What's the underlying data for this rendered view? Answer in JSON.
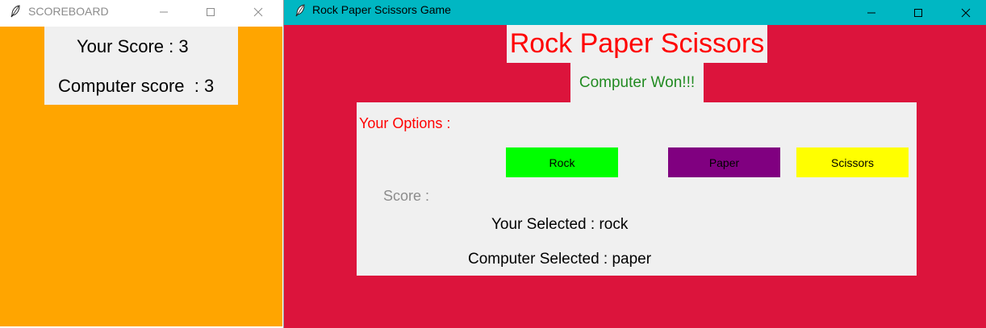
{
  "scoreboard_window": {
    "title": "SCOREBOARD",
    "your_score": "Your Score : 3",
    "computer_score": "Computer score  : 3",
    "colors": {
      "body_bg": "#ffa500",
      "panel_bg": "#f0f0f0"
    }
  },
  "game_window": {
    "title": "Rock Paper Scissors Game",
    "heading": "Rock Paper Scissors",
    "result": "Computer Won!!!",
    "options_label": "Your Options :",
    "buttons": {
      "rock": "Rock",
      "paper": "Paper",
      "scissors": "Scissors"
    },
    "score_label": "Score :",
    "your_selected": "Your Selected : rock",
    "computer_selected": "Computer Selected : paper",
    "colors": {
      "titlebar": "#00b7c3",
      "body_bg": "#dc143c",
      "heading": "#ff0000",
      "result": "#228b22",
      "rock_button": "#00ff00",
      "paper_button": "#800080",
      "scissors_button": "#ffff00"
    }
  },
  "window_controls": {
    "icons": [
      "minimize-icon",
      "maximize-icon",
      "close-icon"
    ]
  }
}
